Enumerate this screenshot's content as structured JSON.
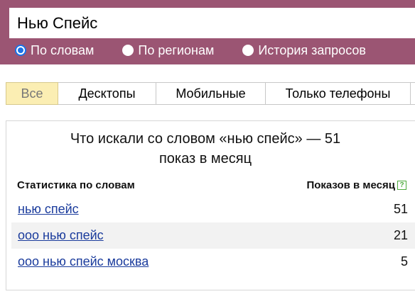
{
  "search": {
    "query": "Нью Спейс",
    "modes": [
      {
        "label": "По словам",
        "checked": true
      },
      {
        "label": "По регионам",
        "checked": false
      },
      {
        "label": "История запросов",
        "checked": false
      }
    ]
  },
  "tabs": [
    {
      "label": "Все",
      "active": true
    },
    {
      "label": "Десктопы",
      "active": false
    },
    {
      "label": "Мобильные",
      "active": false
    },
    {
      "label": "Только телефоны",
      "active": false
    }
  ],
  "results": {
    "title_line1": "Что искали со словом «нью спейс» — 51",
    "title_line2": "показ в месяц",
    "col_keyword": "Статистика по словам",
    "col_count": "Показов в месяц",
    "help_glyph": "?",
    "rows": [
      {
        "phrase": "нью спейс",
        "count": "51"
      },
      {
        "phrase": "ооо нью спейс",
        "count": "21"
      },
      {
        "phrase": "ооо нью спейс москва",
        "count": "5"
      }
    ]
  },
  "colors": {
    "header_bg": "#9b5573",
    "active_tab_bg": "#fbeeb3",
    "link": "#1a3b9c",
    "radio_accent": "#1a73e8"
  }
}
